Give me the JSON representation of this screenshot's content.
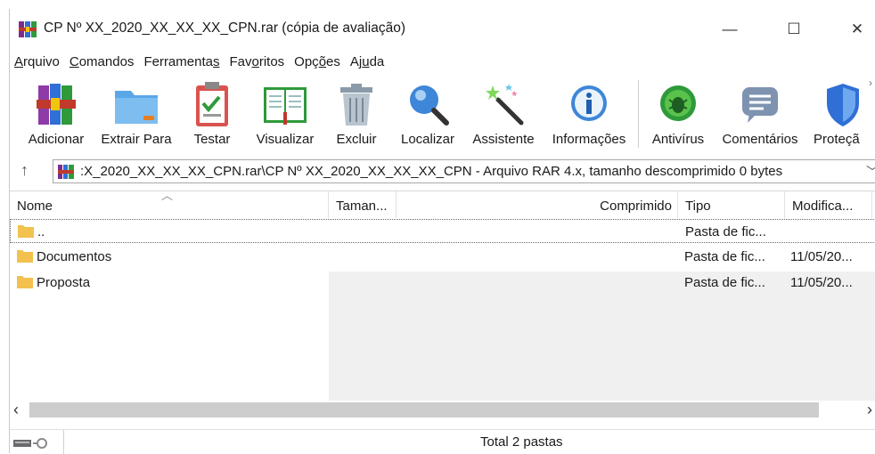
{
  "window": {
    "title": "CP Nº XX_2020_XX_XX_XX_CPN.rar (cópia de avaliação)",
    "controls": {
      "minimize": "—",
      "maximize": "☐",
      "close": "✕"
    }
  },
  "menu": [
    {
      "label": "Arquivo",
      "accel": "A",
      "rest": "rquivo"
    },
    {
      "label": "Comandos",
      "accel": "C",
      "rest": "omandos"
    },
    {
      "label": "Ferramentas",
      "pre": "Ferramenta",
      "accel": "s"
    },
    {
      "label": "Favoritos",
      "pre": "Fav",
      "accel": "o",
      "rest": "ritos"
    },
    {
      "label": "Opções",
      "pre": "Opç",
      "accel": "õ",
      "rest": "es"
    },
    {
      "label": "Ajuda",
      "pre": "Aj",
      "accel": "u",
      "rest": "da"
    }
  ],
  "toolbar": [
    {
      "label": "Adicionar",
      "icon": "archive-books-icon"
    },
    {
      "label": "Extrair Para",
      "icon": "folder-extract-icon"
    },
    {
      "label": "Testar",
      "icon": "clipboard-check-icon"
    },
    {
      "label": "Visualizar",
      "icon": "open-book-icon"
    },
    {
      "label": "Excluir",
      "icon": "trash-icon"
    },
    {
      "label": "Localizar",
      "icon": "magnifier-icon"
    },
    {
      "label": "Assistente",
      "icon": "magic-wand-icon"
    },
    {
      "label": "Informações",
      "icon": "info-icon"
    },
    {
      "label": "Antivírus",
      "icon": "bug-icon"
    },
    {
      "label": "Comentários",
      "icon": "comment-icon"
    },
    {
      "label": "Proteçã",
      "icon": "shield-icon"
    }
  ],
  "path": {
    "text": ":X_2020_XX_XX_XX_CPN.rar\\CP Nº XX_2020_XX_XX_XX_CPN - Arquivo RAR 4.x, tamanho descomprimido 0 bytes"
  },
  "columns": {
    "name": "Nome",
    "size": "Taman...",
    "packed": "Comprimido",
    "type": "Tipo",
    "modified": "Modifica..."
  },
  "rows": [
    {
      "name": "..",
      "type": "Pasta de fic...",
      "modified": ""
    },
    {
      "name": "Documentos",
      "type": "Pasta de fic...",
      "modified": "11/05/20..."
    },
    {
      "name": "Proposta",
      "type": "Pasta de fic...",
      "modified": "11/05/20..."
    }
  ],
  "status": {
    "text": "Total 2 pastas"
  },
  "colors": {
    "accent_blue": "#1f6fd1",
    "folder_yellow": "#f2c14e",
    "selection_border": "#6a6a6a"
  }
}
